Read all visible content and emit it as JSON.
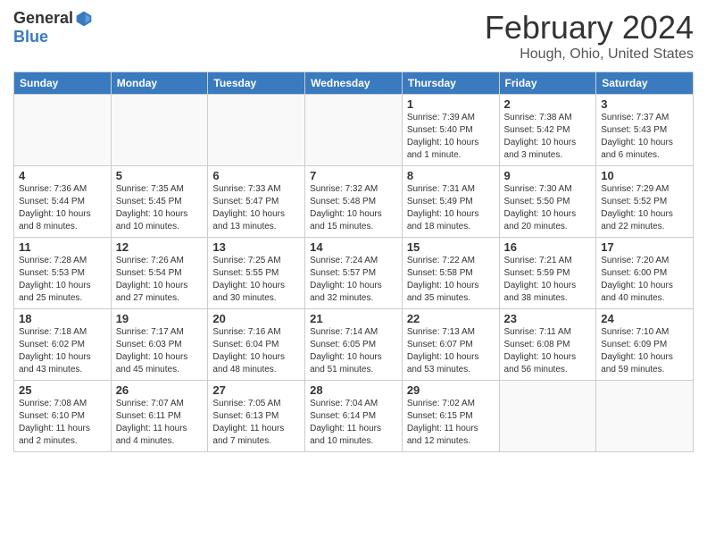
{
  "header": {
    "logo": {
      "general": "General",
      "blue": "Blue"
    },
    "title": "February 2024",
    "location": "Hough, Ohio, United States"
  },
  "calendar": {
    "headers": [
      "Sunday",
      "Monday",
      "Tuesday",
      "Wednesday",
      "Thursday",
      "Friday",
      "Saturday"
    ],
    "weeks": [
      [
        {
          "day": "",
          "info": ""
        },
        {
          "day": "",
          "info": ""
        },
        {
          "day": "",
          "info": ""
        },
        {
          "day": "",
          "info": ""
        },
        {
          "day": "1",
          "info": "Sunrise: 7:39 AM\nSunset: 5:40 PM\nDaylight: 10 hours\nand 1 minute."
        },
        {
          "day": "2",
          "info": "Sunrise: 7:38 AM\nSunset: 5:42 PM\nDaylight: 10 hours\nand 3 minutes."
        },
        {
          "day": "3",
          "info": "Sunrise: 7:37 AM\nSunset: 5:43 PM\nDaylight: 10 hours\nand 6 minutes."
        }
      ],
      [
        {
          "day": "4",
          "info": "Sunrise: 7:36 AM\nSunset: 5:44 PM\nDaylight: 10 hours\nand 8 minutes."
        },
        {
          "day": "5",
          "info": "Sunrise: 7:35 AM\nSunset: 5:45 PM\nDaylight: 10 hours\nand 10 minutes."
        },
        {
          "day": "6",
          "info": "Sunrise: 7:33 AM\nSunset: 5:47 PM\nDaylight: 10 hours\nand 13 minutes."
        },
        {
          "day": "7",
          "info": "Sunrise: 7:32 AM\nSunset: 5:48 PM\nDaylight: 10 hours\nand 15 minutes."
        },
        {
          "day": "8",
          "info": "Sunrise: 7:31 AM\nSunset: 5:49 PM\nDaylight: 10 hours\nand 18 minutes."
        },
        {
          "day": "9",
          "info": "Sunrise: 7:30 AM\nSunset: 5:50 PM\nDaylight: 10 hours\nand 20 minutes."
        },
        {
          "day": "10",
          "info": "Sunrise: 7:29 AM\nSunset: 5:52 PM\nDaylight: 10 hours\nand 22 minutes."
        }
      ],
      [
        {
          "day": "11",
          "info": "Sunrise: 7:28 AM\nSunset: 5:53 PM\nDaylight: 10 hours\nand 25 minutes."
        },
        {
          "day": "12",
          "info": "Sunrise: 7:26 AM\nSunset: 5:54 PM\nDaylight: 10 hours\nand 27 minutes."
        },
        {
          "day": "13",
          "info": "Sunrise: 7:25 AM\nSunset: 5:55 PM\nDaylight: 10 hours\nand 30 minutes."
        },
        {
          "day": "14",
          "info": "Sunrise: 7:24 AM\nSunset: 5:57 PM\nDaylight: 10 hours\nand 32 minutes."
        },
        {
          "day": "15",
          "info": "Sunrise: 7:22 AM\nSunset: 5:58 PM\nDaylight: 10 hours\nand 35 minutes."
        },
        {
          "day": "16",
          "info": "Sunrise: 7:21 AM\nSunset: 5:59 PM\nDaylight: 10 hours\nand 38 minutes."
        },
        {
          "day": "17",
          "info": "Sunrise: 7:20 AM\nSunset: 6:00 PM\nDaylight: 10 hours\nand 40 minutes."
        }
      ],
      [
        {
          "day": "18",
          "info": "Sunrise: 7:18 AM\nSunset: 6:02 PM\nDaylight: 10 hours\nand 43 minutes."
        },
        {
          "day": "19",
          "info": "Sunrise: 7:17 AM\nSunset: 6:03 PM\nDaylight: 10 hours\nand 45 minutes."
        },
        {
          "day": "20",
          "info": "Sunrise: 7:16 AM\nSunset: 6:04 PM\nDaylight: 10 hours\nand 48 minutes."
        },
        {
          "day": "21",
          "info": "Sunrise: 7:14 AM\nSunset: 6:05 PM\nDaylight: 10 hours\nand 51 minutes."
        },
        {
          "day": "22",
          "info": "Sunrise: 7:13 AM\nSunset: 6:07 PM\nDaylight: 10 hours\nand 53 minutes."
        },
        {
          "day": "23",
          "info": "Sunrise: 7:11 AM\nSunset: 6:08 PM\nDaylight: 10 hours\nand 56 minutes."
        },
        {
          "day": "24",
          "info": "Sunrise: 7:10 AM\nSunset: 6:09 PM\nDaylight: 10 hours\nand 59 minutes."
        }
      ],
      [
        {
          "day": "25",
          "info": "Sunrise: 7:08 AM\nSunset: 6:10 PM\nDaylight: 11 hours\nand 2 minutes."
        },
        {
          "day": "26",
          "info": "Sunrise: 7:07 AM\nSunset: 6:11 PM\nDaylight: 11 hours\nand 4 minutes."
        },
        {
          "day": "27",
          "info": "Sunrise: 7:05 AM\nSunset: 6:13 PM\nDaylight: 11 hours\nand 7 minutes."
        },
        {
          "day": "28",
          "info": "Sunrise: 7:04 AM\nSunset: 6:14 PM\nDaylight: 11 hours\nand 10 minutes."
        },
        {
          "day": "29",
          "info": "Sunrise: 7:02 AM\nSunset: 6:15 PM\nDaylight: 11 hours\nand 12 minutes."
        },
        {
          "day": "",
          "info": ""
        },
        {
          "day": "",
          "info": ""
        }
      ]
    ]
  }
}
